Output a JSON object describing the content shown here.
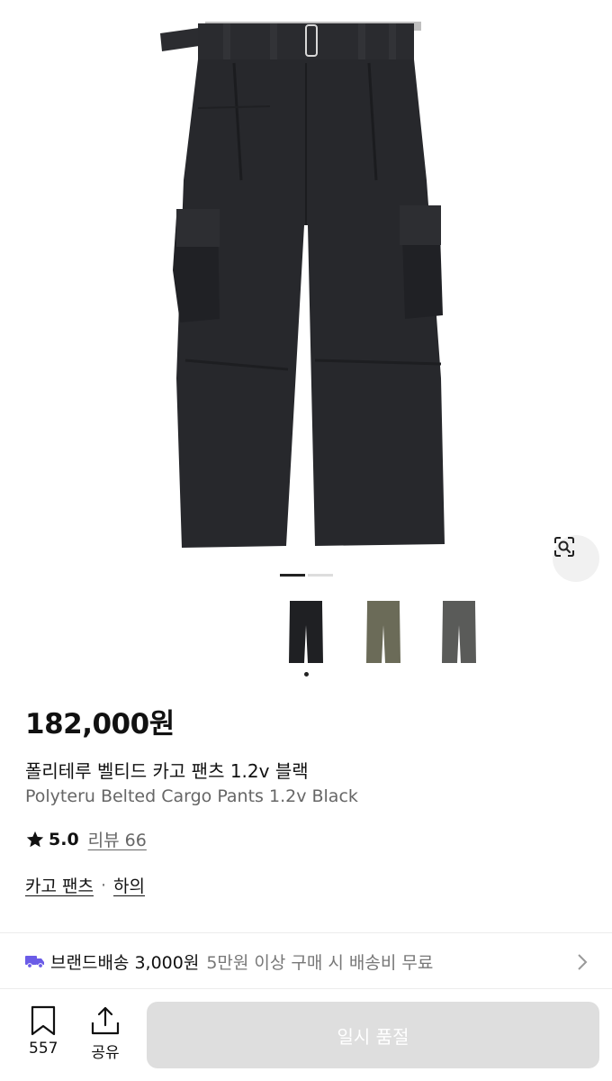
{
  "product": {
    "price": "182,000원",
    "name_ko": "폴리테루 벨티드 카고 팬츠 1.2v 블랙",
    "name_en": "Polyteru Belted Cargo Pants 1.2v Black",
    "rating_score": "5.0",
    "review_label": "리뷰 66",
    "category_primary": "카고 팬츠",
    "category_separator": "·",
    "category_secondary": "하의"
  },
  "gallery": {
    "page_index": 1,
    "page_count": 2,
    "swatch_colors": [
      "#1f2023",
      "#6b6b58",
      "#5a5b59"
    ],
    "selected_swatch": 0
  },
  "shipping": {
    "label": "브랜드배송 3,000원",
    "note": "5만원 이상 구매 시 배송비 무료"
  },
  "actions": {
    "bookmark_count": "557",
    "share_label": "공유",
    "cta_label": "일시 품절"
  },
  "icons": {
    "lens": "lens-search-icon",
    "star": "star-icon",
    "truck": "truck-icon",
    "chevron": "chevron-right-icon",
    "bookmark": "bookmark-icon",
    "share": "share-icon"
  },
  "colors": {
    "truck": "#6b5ce7",
    "cta_bg": "#dedede",
    "pants": "#26272b"
  }
}
